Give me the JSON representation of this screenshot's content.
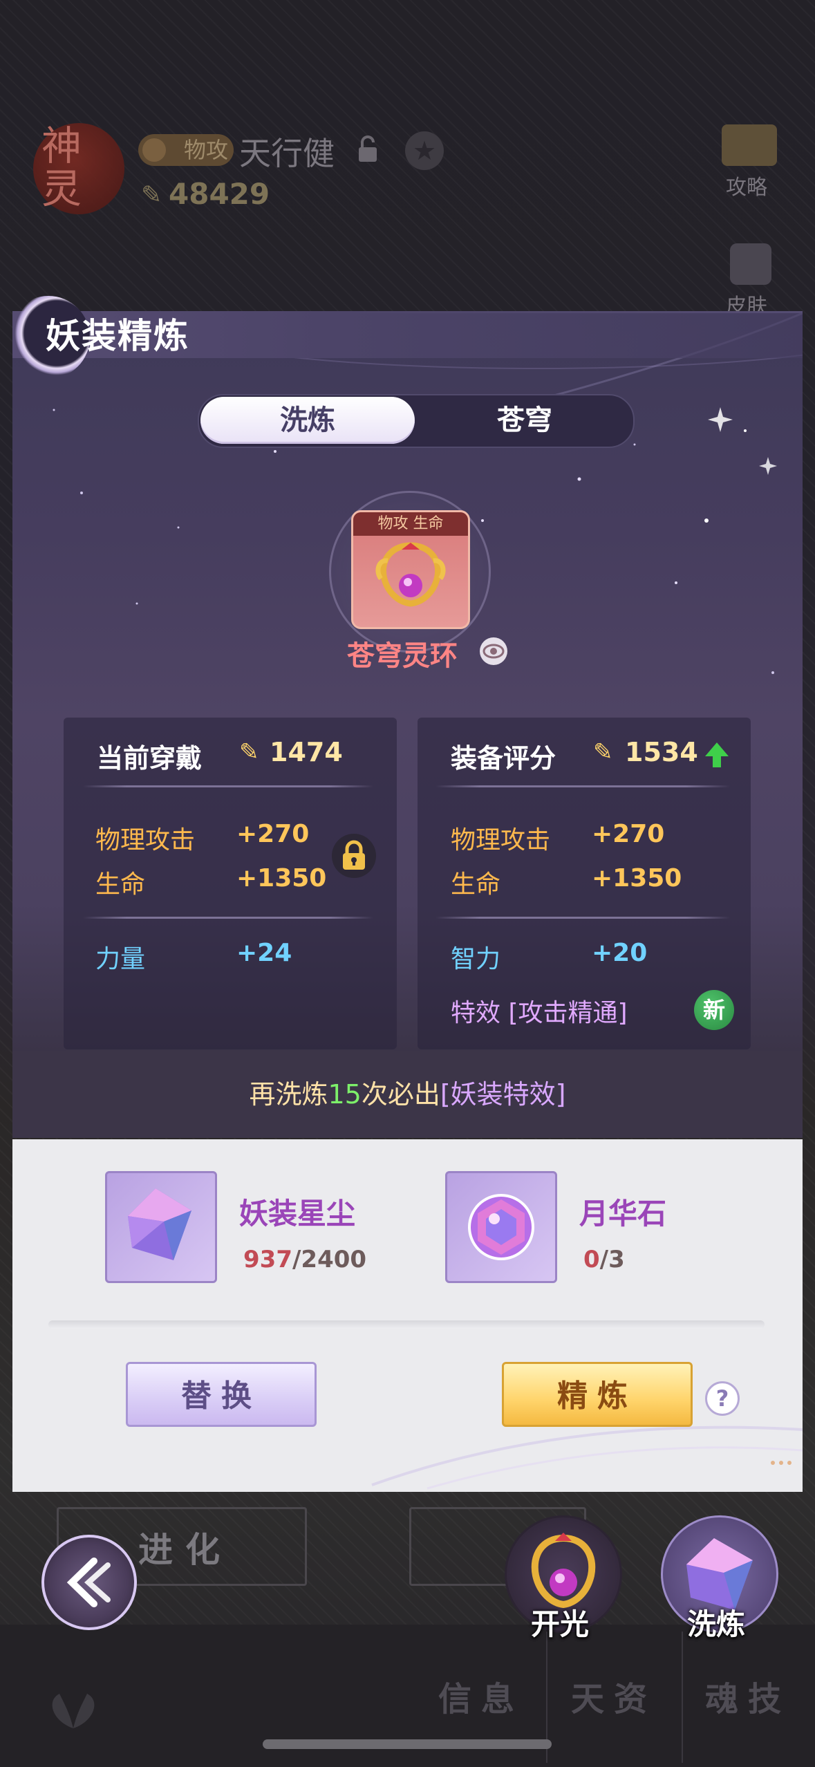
{
  "background": {
    "seal_text": "神\n灵",
    "tag_label": "物攻",
    "hero_name": "天行健",
    "power_value": "48429",
    "side_items": [
      "攻略",
      "皮肤"
    ]
  },
  "panel": {
    "title": "妖装精炼",
    "tabs": [
      {
        "label": "洗炼",
        "active": true
      },
      {
        "label": "苍穹",
        "active": false
      }
    ],
    "item": {
      "tags": "物攻 生命",
      "name": "苍穹灵环"
    },
    "current": {
      "header": "当前穿戴",
      "score": "1474",
      "stats": [
        {
          "name": "物理攻击",
          "value": "+270"
        },
        {
          "name": "生命",
          "value": "+1350"
        }
      ],
      "extra": {
        "name": "力量",
        "value": "+24"
      }
    },
    "rating": {
      "header": "装备评分",
      "score": "1534",
      "stats": [
        {
          "name": "物理攻击",
          "value": "+270"
        },
        {
          "name": "生命",
          "value": "+1350"
        }
      ],
      "extra": {
        "name": "智力",
        "value": "+20"
      },
      "effect": "特效 [攻击精通]",
      "new_badge": "新"
    },
    "notice": {
      "prefix": "再洗炼",
      "count": "15",
      "middle": "次必出",
      "effect": "[妖装特效]"
    }
  },
  "materials": [
    {
      "name": "妖装星尘",
      "have": "937",
      "need": "2400"
    },
    {
      "name": "月华石",
      "have": "0",
      "need": "3"
    }
  ],
  "buttons": {
    "replace": "替换",
    "refine": "精炼",
    "help": "?"
  },
  "bottom": {
    "evolve": "进化",
    "open_light": "开光",
    "wash": "洗炼",
    "nav": [
      "信息",
      "天资",
      "魂技"
    ]
  },
  "colors": {
    "accent_gold": "#ffc65a",
    "accent_blue": "#71d2ff",
    "accent_purple": "#e1aaff",
    "item_name": "#ff8585",
    "count_green": "#7df06a"
  }
}
